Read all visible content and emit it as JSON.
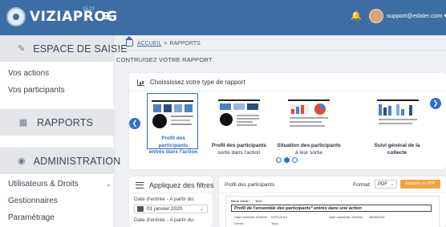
{
  "app": {
    "name": "VIZIAPROG",
    "version": "15.27",
    "user_email": "support@edaler.com",
    "colors": {
      "topbar": "#3e6da6",
      "accent": "#2f6fc4",
      "export": "#f5a340"
    }
  },
  "sidebar": {
    "espace_title": "ESPACE DE SAISIE",
    "links_top": [
      "Vos actions",
      "Vos participants"
    ],
    "rapports_title": "RAPPORTS",
    "admin_title": "ADMINISTRATION",
    "links_bottom": [
      "Utilisateurs & Droits",
      "Gestionnaires",
      "Paramétrage"
    ]
  },
  "breadcrumb": {
    "home": "ACCUEIL",
    "separator": ">",
    "current": "RAPPORTS"
  },
  "page": {
    "title": "CONTRUISEZ VOTRE RAPPORT"
  },
  "report_types": {
    "heading": "Choississez votre type de rapport",
    "items": [
      {
        "title": "Profil des participants",
        "sub": "entrés dans l'action",
        "selected": true
      },
      {
        "title": "Profil des participants",
        "sub": "sortis dans l'action",
        "selected": false
      },
      {
        "title": "Situation des participants",
        "sub": "à leur sortie",
        "selected": false
      },
      {
        "title": "Suivi général de la",
        "sub": "collecte",
        "selected": false
      }
    ],
    "page_index": 2,
    "page_count": 3
  },
  "filters": {
    "title": "Appliquez des filtres",
    "label1": "Date d'entrée - A partir du:",
    "value1": "01 janvier 2020",
    "label2": "Date d'entrée - A partir du:"
  },
  "preview": {
    "title": "Profil des participants",
    "format_label": "Format:",
    "format_value": "PDF",
    "export_label": "Exporter en PDF",
    "doc_header_left": "Nous client :",
    "doc_header_right": "Test",
    "doc_heading": "Profil de l'ensemble des participants* entrés dans une action",
    "row1_label": "Date minimale d'entrée :",
    "row1_value": "01/01/2014",
    "row2_label": "Date maximale d'entrée :",
    "row2_value": "08/06/2021",
    "row3_label": "Genre :",
    "row3_value": "Tous"
  }
}
